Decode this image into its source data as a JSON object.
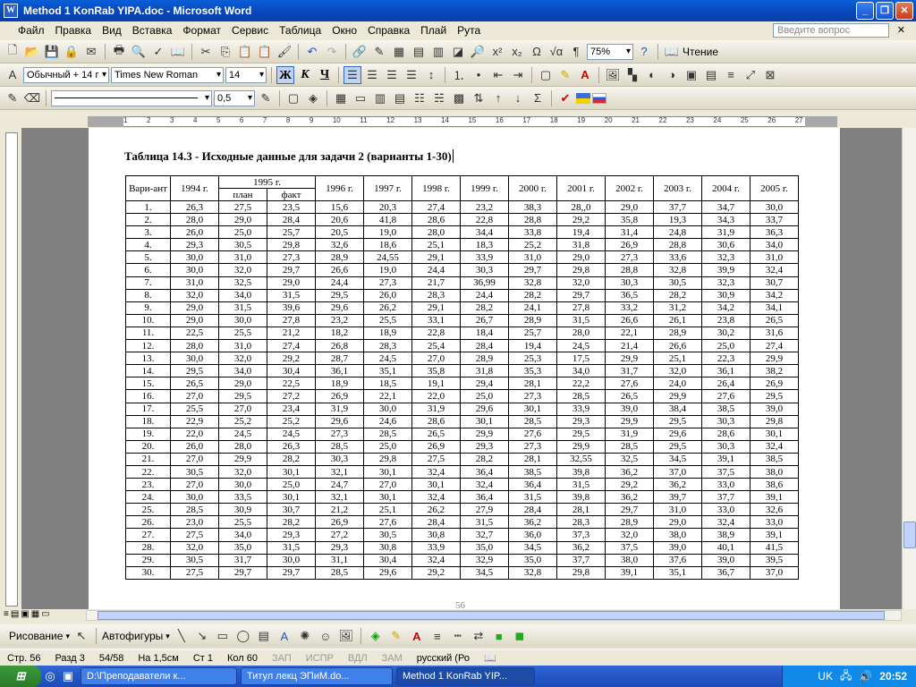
{
  "window": {
    "title": "Method 1 KonRab YIPA.doc - Microsoft Word"
  },
  "menu": [
    "Файл",
    "Правка",
    "Вид",
    "Вставка",
    "Формат",
    "Сервис",
    "Таблица",
    "Окно",
    "Справка",
    "Плай",
    "Рута"
  ],
  "ask_placeholder": "Введите вопрос",
  "toolbar": {
    "zoom": "75%",
    "reading": "Чтение",
    "style": "Обычный + 14 г",
    "font": "Times New Roman",
    "size": "14",
    "bold": "Ж",
    "italic": "К",
    "underline": "Ч",
    "line_width": "0,5"
  },
  "document": {
    "caption": "Таблица 14.3 - Исходные данные для задачи 2 (варианты 1-30)",
    "page_number": "56",
    "headers": {
      "variant": "Вари-ант",
      "y1994": "1994 г.",
      "y1995": "1995 г.",
      "plan": "план",
      "fact": "факт",
      "years": [
        "1996 г.",
        "1997 г.",
        "1998 г.",
        "1999 г.",
        "2000 г.",
        "2001 г.",
        "2002 г.",
        "2003 г.",
        "2004 г.",
        "2005 г."
      ]
    },
    "rows": [
      [
        "1.",
        "26,3",
        "27,5",
        "23,5",
        "15,6",
        "20,3",
        "27,4",
        "23,2",
        "38,3",
        "28,,0",
        "29,0",
        "37,7",
        "34,7",
        "30,0"
      ],
      [
        "2.",
        "28,0",
        "29,0",
        "28,4",
        "20,6",
        "41,8",
        "28,6",
        "22,8",
        "28,8",
        "29,2",
        "35,8",
        "19,3",
        "34,3",
        "33,7"
      ],
      [
        "3.",
        "26,0",
        "25,0",
        "25,7",
        "20,5",
        "19,0",
        "28,0",
        "34,4",
        "33,8",
        "19,4",
        "31,4",
        "24,8",
        "31,9",
        "36,3"
      ],
      [
        "4.",
        "29,3",
        "30,5",
        "29,8",
        "32,6",
        "18,6",
        "25,1",
        "18,3",
        "25,2",
        "31,8",
        "26,9",
        "28,8",
        "30,6",
        "34,0"
      ],
      [
        "5.",
        "30,0",
        "31,0",
        "27,3",
        "28,9",
        "24,55",
        "29,1",
        "33,9",
        "31,0",
        "29,0",
        "27,3",
        "33,6",
        "32,3",
        "31,0"
      ],
      [
        "6.",
        "30,0",
        "32,0",
        "29,7",
        "26,6",
        "19,0",
        "24,4",
        "30,3",
        "29,7",
        "29,8",
        "28,8",
        "32,8",
        "39,9",
        "32,4"
      ],
      [
        "7.",
        "31,0",
        "32,5",
        "29,0",
        "24,4",
        "27,3",
        "21,7",
        "36,99",
        "32,8",
        "32,0",
        "30,3",
        "30,5",
        "32,3",
        "30,7"
      ],
      [
        "8.",
        "32,0",
        "34,0",
        "31,5",
        "29,5",
        "26,0",
        "28,3",
        "24,4",
        "28,2",
        "29,7",
        "36,5",
        "28,2",
        "30,9",
        "34,2"
      ],
      [
        "9.",
        "29,0",
        "31,5",
        "39,6",
        "29,6",
        "26,2",
        "29,1",
        "28,2",
        "24,1",
        "27,8",
        "33,2",
        "31,2",
        "34,2",
        "34,1"
      ],
      [
        "10.",
        "29,0",
        "30,0",
        "27,8",
        "23,2",
        "25,5",
        "33,1",
        "26,7",
        "28,9",
        "31,5",
        "26,6",
        "26,1",
        "23,8",
        "26,5"
      ],
      [
        "11.",
        "22,5",
        "25,5",
        "21,2",
        "18,2",
        "18,9",
        "22,8",
        "18,4",
        "25,7",
        "28,0",
        "22,1",
        "28,9",
        "30,2",
        "31,6"
      ],
      [
        "12.",
        "28,0",
        "31,0",
        "27,4",
        "26,8",
        "28,3",
        "25,4",
        "28,4",
        "19,4",
        "24,5",
        "21,4",
        "26,6",
        "25,0",
        "27,4"
      ],
      [
        "13.",
        "30,0",
        "32,0",
        "29,2",
        "28,7",
        "24,5",
        "27,0",
        "28,9",
        "25,3",
        "17,5",
        "29,9",
        "25,1",
        "22,3",
        "29,9"
      ],
      [
        "14.",
        "29,5",
        "34,0",
        "30,4",
        "36,1",
        "35,1",
        "35,8",
        "31,8",
        "35,3",
        "34,0",
        "31,7",
        "32,0",
        "36,1",
        "38,2"
      ],
      [
        "15.",
        "26,5",
        "29,0",
        "22,5",
        "18,9",
        "18,5",
        "19,1",
        "29,4",
        "28,1",
        "22,2",
        "27,6",
        "24,0",
        "26,4",
        "26,9"
      ],
      [
        "16.",
        "27,0",
        "29,5",
        "27,2",
        "26,9",
        "22,1",
        "22,0",
        "25,0",
        "27,3",
        "28,5",
        "26,5",
        "29,9",
        "27,6",
        "29,5"
      ],
      [
        "17.",
        "25,5",
        "27,0",
        "23,4",
        "31,9",
        "30,0",
        "31,9",
        "29,6",
        "30,1",
        "33,9",
        "39,0",
        "38,4",
        "38,5",
        "39,0"
      ],
      [
        "18.",
        "22,9",
        "25,2",
        "25,2",
        "29,6",
        "24,6",
        "28,6",
        "30,1",
        "28,5",
        "29,3",
        "29,9",
        "29,5",
        "30,3",
        "29,8"
      ],
      [
        "19.",
        "22,0",
        "24,5",
        "24,5",
        "27,3",
        "28,5",
        "26,5",
        "29,9",
        "27,6",
        "29,5",
        "31,9",
        "29,6",
        "28,6",
        "30,1"
      ],
      [
        "20.",
        "26,0",
        "28,0",
        "26,3",
        "28,5",
        "25,0",
        "26,9",
        "29,3",
        "27,3",
        "29,9",
        "28,5",
        "29,5",
        "30,3",
        "32,4"
      ],
      [
        "21.",
        "27,0",
        "29,9",
        "28,2",
        "30,3",
        "29,8",
        "27,5",
        "28,2",
        "28,1",
        "32,55",
        "32,5",
        "34,5",
        "39,1",
        "38,5"
      ],
      [
        "22.",
        "30,5",
        "32,0",
        "30,1",
        "32,1",
        "30,1",
        "32,4",
        "36,4",
        "38,5",
        "39,8",
        "36,2",
        "37,0",
        "37,5",
        "38,0"
      ],
      [
        "23.",
        "27,0",
        "30,0",
        "25,0",
        "24,7",
        "27,0",
        "30,1",
        "32,4",
        "36,4",
        "31,5",
        "29,2",
        "36,2",
        "33,0",
        "38,6"
      ],
      [
        "24.",
        "30,0",
        "33,5",
        "30,1",
        "32,1",
        "30,1",
        "32,4",
        "36,4",
        "31,5",
        "39,8",
        "36,2",
        "39,7",
        "37,7",
        "39,1"
      ],
      [
        "25.",
        "28,5",
        "30,9",
        "30,7",
        "21,2",
        "25,1",
        "26,2",
        "27,9",
        "28,4",
        "28,1",
        "29,7",
        "31,0",
        "33,0",
        "32,6"
      ],
      [
        "26.",
        "23,0",
        "25,5",
        "28,2",
        "26,9",
        "27,6",
        "28,4",
        "31,5",
        "36,2",
        "28,3",
        "28,9",
        "29,0",
        "32,4",
        "33,0"
      ],
      [
        "27.",
        "27,5",
        "34,0",
        "29,3",
        "27,2",
        "30,5",
        "30,8",
        "32,7",
        "36,0",
        "37,3",
        "32,0",
        "38,0",
        "38,9",
        "39,1"
      ],
      [
        "28.",
        "32,0",
        "35,0",
        "31,5",
        "29,3",
        "30,8",
        "33,9",
        "35,0",
        "34,5",
        "36,2",
        "37,5",
        "39,0",
        "40,1",
        "41,5"
      ],
      [
        "29.",
        "30,5",
        "31,7",
        "30,0",
        "31,1",
        "30,4",
        "32,4",
        "32,9",
        "35,0",
        "37,7",
        "38,0",
        "37,6",
        "39,0",
        "39,5"
      ],
      [
        "30.",
        "27,5",
        "29,7",
        "29,7",
        "28,5",
        "29,6",
        "29,2",
        "34,5",
        "32,8",
        "29,8",
        "39,1",
        "35,1",
        "36,7",
        "37,0"
      ]
    ]
  },
  "draw": {
    "drawing": "Рисование",
    "autoshapes": "Автофигуры"
  },
  "status": {
    "page": "Стр. 56",
    "section": "Разд 3",
    "pages": "54/58",
    "at": "На 1,5см",
    "line": "Ст 1",
    "col": "Кол 60",
    "rec": "ЗАП",
    "trk": "ИСПР",
    "ext": "ВДЛ",
    "ovr": "ЗАМ",
    "lang": "русский (Ро"
  },
  "taskbar": {
    "tasks": [
      "D:\\Преподаватели к...",
      "Титул лекц ЭПиМ.do...",
      "Method 1 KonRab YIP..."
    ],
    "lang": "UK",
    "time": "20:52"
  }
}
